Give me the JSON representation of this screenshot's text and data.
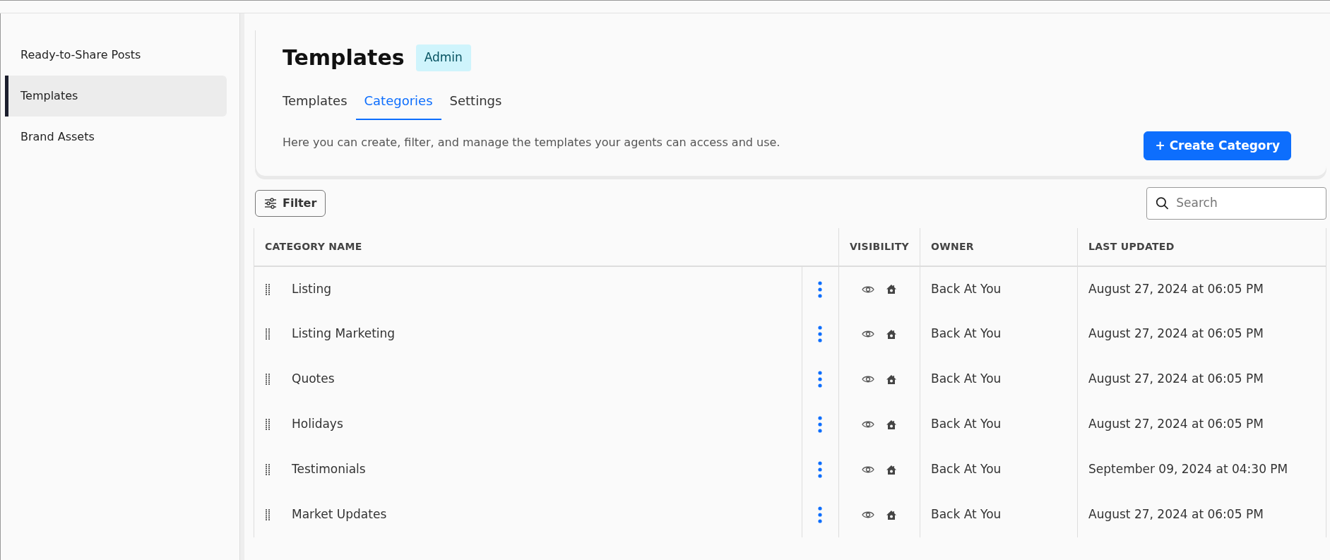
{
  "sidebar": {
    "items": [
      {
        "label": "Ready-to-Share Posts",
        "selected": false
      },
      {
        "label": "Templates",
        "selected": true
      },
      {
        "label": "Brand Assets",
        "selected": false
      }
    ]
  },
  "header": {
    "title": "Templates",
    "badge": "Admin",
    "tabs": [
      {
        "label": "Templates",
        "selected": false
      },
      {
        "label": "Categories",
        "selected": true
      },
      {
        "label": "Settings",
        "selected": false
      }
    ],
    "description": "Here you can create, filter, and manage the templates your agents can access and use.",
    "create_button": "+ Create Category"
  },
  "toolbar": {
    "filter_button": "Filter",
    "search": {
      "placeholder": "Search"
    }
  },
  "table": {
    "columns": [
      "CATEGORY NAME",
      "VISIBILITY",
      "OWNER",
      "LAST UPDATED"
    ],
    "rows": [
      {
        "name": "Listing",
        "owner": "Back At You",
        "last_updated": "August 27, 2024 at 06:05 PM"
      },
      {
        "name": "Listing Marketing",
        "owner": "Back At You",
        "last_updated": "August 27, 2024 at 06:05 PM"
      },
      {
        "name": "Quotes",
        "owner": "Back At You",
        "last_updated": "August 27, 2024 at 06:05 PM"
      },
      {
        "name": "Holidays",
        "owner": "Back At You",
        "last_updated": "August 27, 2024 at 06:05 PM"
      },
      {
        "name": "Testimonials",
        "owner": "Back At You",
        "last_updated": "September 09, 2024 at 04:30 PM"
      },
      {
        "name": "Market Updates",
        "owner": "Back At You",
        "last_updated": "August 27, 2024 at 06:05 PM"
      }
    ]
  }
}
